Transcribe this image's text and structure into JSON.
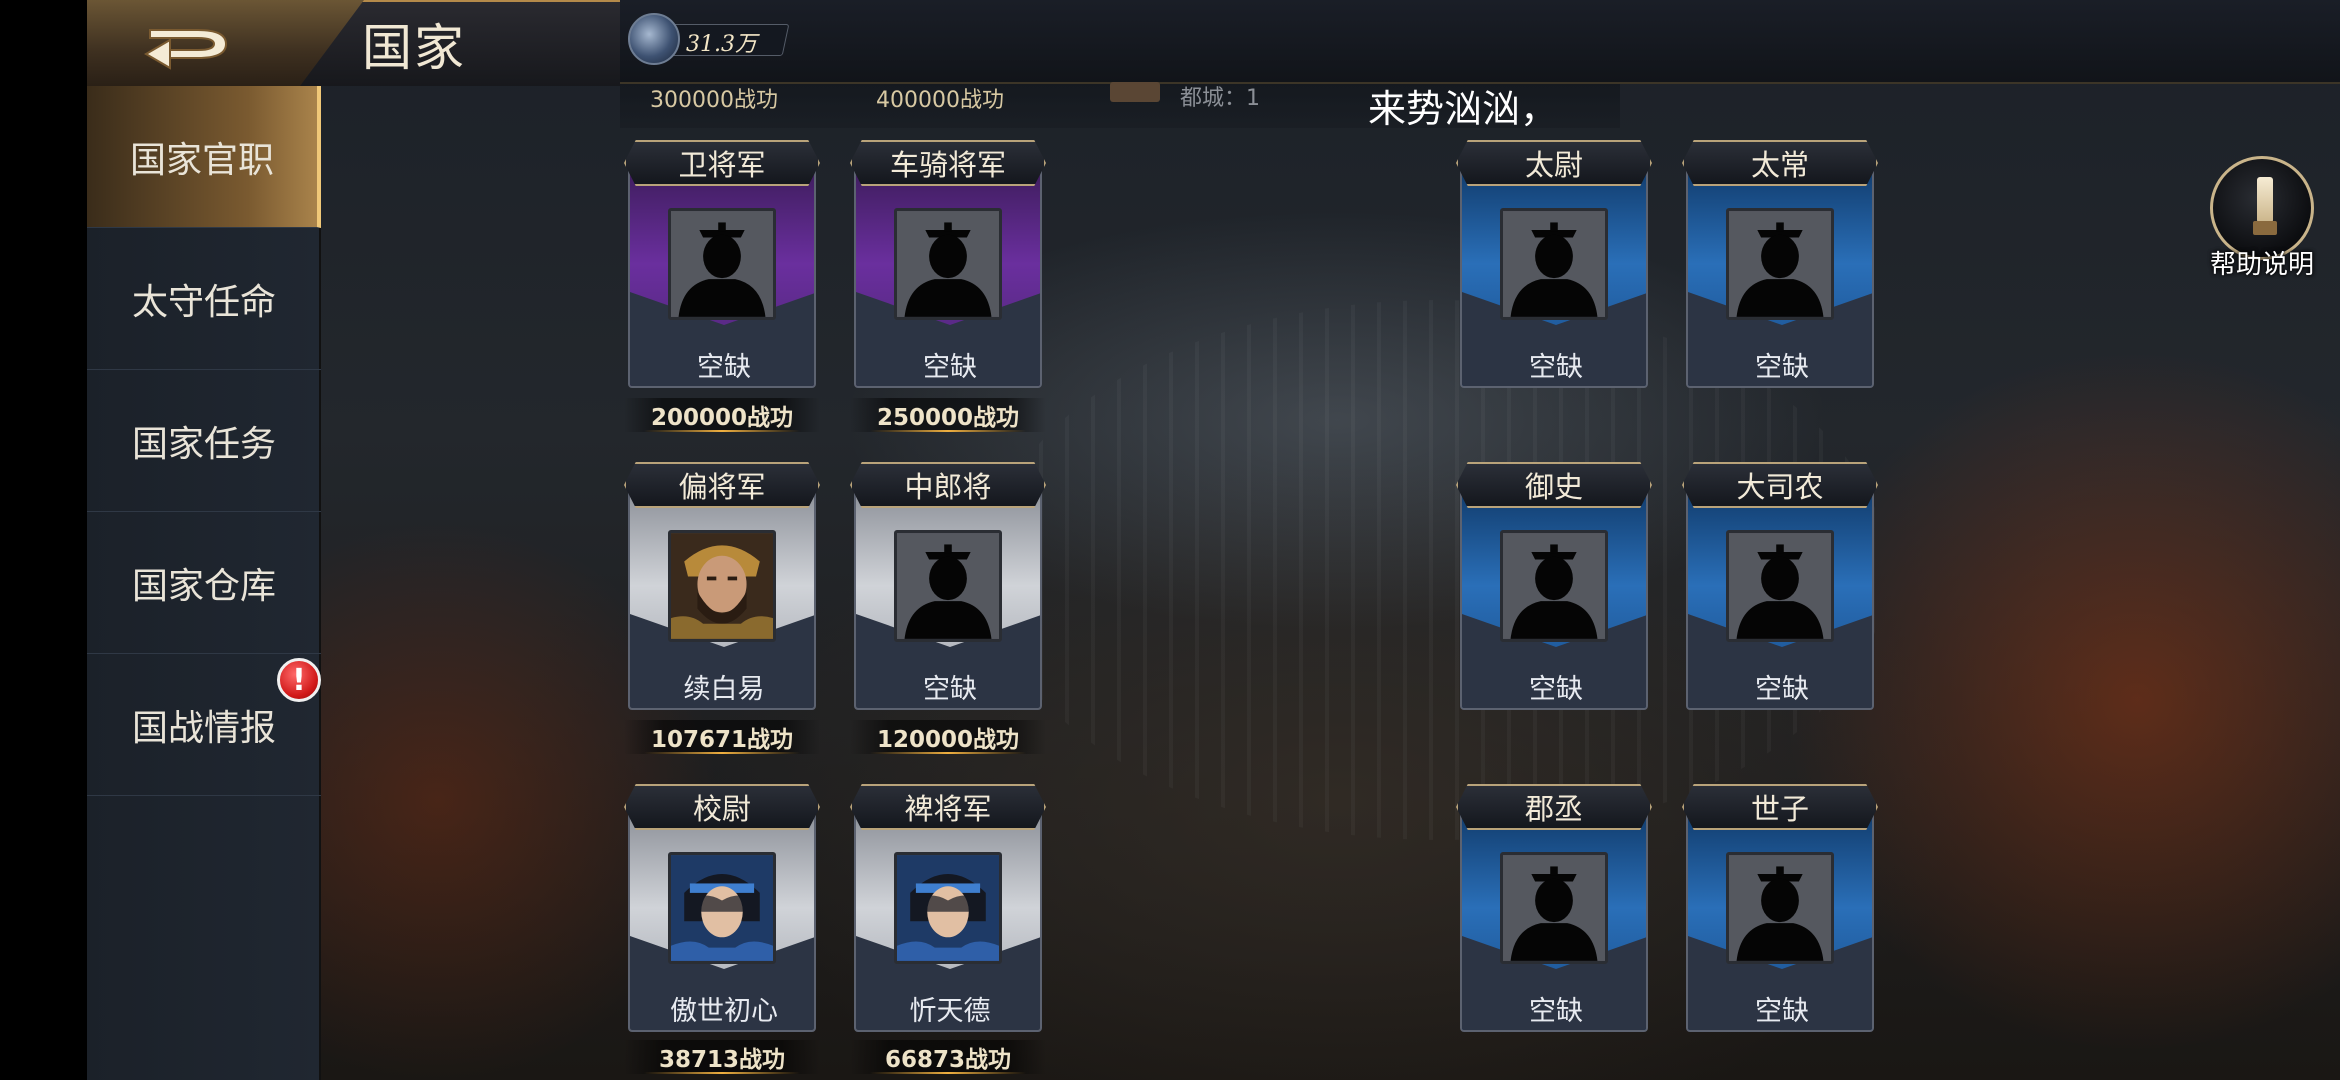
{
  "header": {
    "title": "国家",
    "currency_value": "31.3万",
    "back_icon": "back-arrow-icon",
    "currency_icon": "globe-icon"
  },
  "sidebar": {
    "items": [
      {
        "label": "国家官职",
        "active": true
      },
      {
        "label": "太守任命",
        "active": false
      },
      {
        "label": "国家任务",
        "active": false
      },
      {
        "label": "国家仓库",
        "active": false
      },
      {
        "label": "国战情报",
        "active": false
      }
    ],
    "alert_badge": "!"
  },
  "ticker": {
    "merit_left": "300000战功",
    "merit_right": "400000战功",
    "note": "都城：1",
    "text": "来势汹汹，"
  },
  "positions": {
    "left": [
      {
        "title": "卫将军",
        "name": "空缺",
        "merit": "200000战功",
        "theme": "purple",
        "portrait": "silhouette"
      },
      {
        "title": "车骑将军",
        "name": "空缺",
        "merit": "250000战功",
        "theme": "purple",
        "portrait": "silhouette"
      },
      {
        "title": "偏将军",
        "name": "续白易",
        "merit": "107671战功",
        "theme": "silver",
        "portrait": "bearded-general"
      },
      {
        "title": "中郎将",
        "name": "空缺",
        "merit": "120000战功",
        "theme": "silver",
        "portrait": "silhouette"
      },
      {
        "title": "校尉",
        "name": "傲世初心",
        "merit": "38713战功",
        "theme": "silver",
        "portrait": "young-hero"
      },
      {
        "title": "裨将军",
        "name": "忻天德",
        "merit": "66873战功",
        "theme": "silver",
        "portrait": "young-hero"
      }
    ],
    "right": [
      {
        "title": "太尉",
        "name": "空缺",
        "theme": "blue",
        "portrait": "silhouette"
      },
      {
        "title": "太常",
        "name": "空缺",
        "theme": "blue",
        "portrait": "silhouette"
      },
      {
        "title": "御史",
        "name": "空缺",
        "theme": "blue",
        "portrait": "silhouette"
      },
      {
        "title": "大司农",
        "name": "空缺",
        "theme": "blue",
        "portrait": "silhouette"
      },
      {
        "title": "郡丞",
        "name": "空缺",
        "theme": "blue",
        "portrait": "silhouette"
      },
      {
        "title": "世子",
        "name": "空缺",
        "theme": "blue",
        "portrait": "silhouette"
      }
    ]
  },
  "help": {
    "label": "帮助说明",
    "icon": "scroll-help-icon"
  },
  "colors": {
    "accent_gold": "#b9a37a",
    "purple_card": "#6a2f9e",
    "blue_card": "#2a6fb8",
    "silver_card": "#d0d3d8",
    "alert_red": "#d01818"
  }
}
